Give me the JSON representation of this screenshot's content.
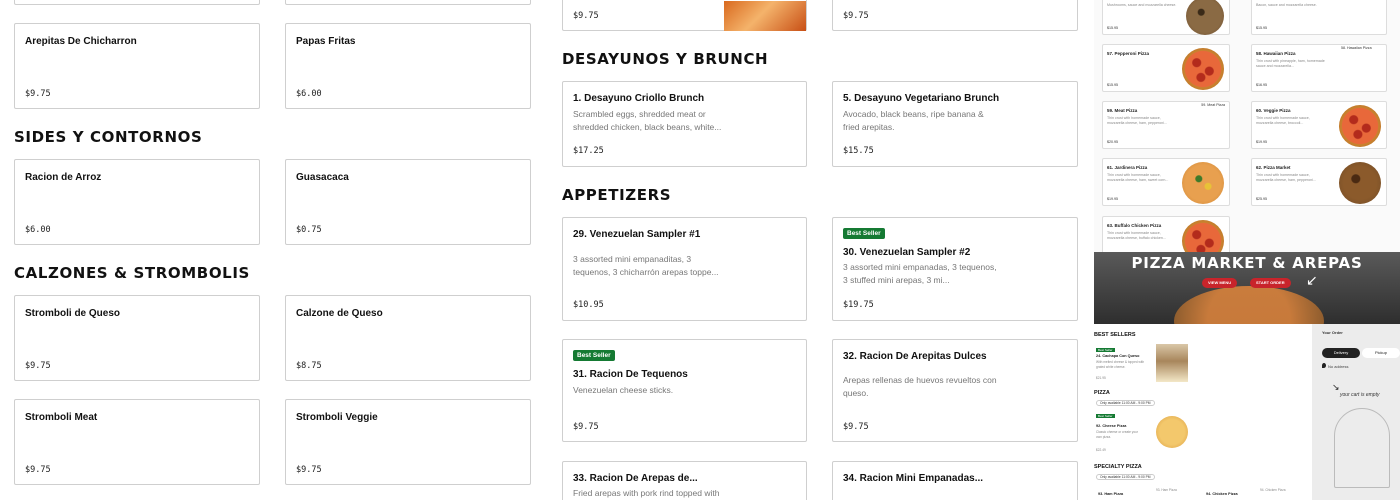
{
  "col1": {
    "top_cards": [
      {
        "name": "",
        "price": ""
      },
      {
        "name": "",
        "price": ""
      }
    ],
    "cards_a": [
      {
        "name": "Arepitas De Chicharron",
        "price": "$9.75"
      },
      {
        "name": "Papas Fritas",
        "price": "$6.00"
      }
    ],
    "sides_title": "SIDES Y CONTORNOS",
    "sides": [
      {
        "name": "Racion de Arroz",
        "price": "$6.00"
      },
      {
        "name": "Guasacaca",
        "price": "$0.75"
      }
    ],
    "calzones_title": "CALZONES & STROMBOLIS",
    "calzones": [
      {
        "name": "Stromboli de Queso",
        "price": "$9.75"
      },
      {
        "name": "Calzone de Queso",
        "price": "$8.75"
      },
      {
        "name": "Stromboli Meat",
        "price": "$9.75"
      },
      {
        "name": "Stromboli Veggie",
        "price": "$9.75"
      }
    ]
  },
  "col2": {
    "top_cards": [
      {
        "price": "$9.75"
      },
      {
        "price": "$9.75"
      }
    ],
    "desayunos_title": "DESAYUNOS Y BRUNCH",
    "desayunos": [
      {
        "name": "1. Desayuno Criollo Brunch",
        "desc": "Scrambled eggs, shredded meat or shredded chicken, black beans, white...",
        "price": "$17.25"
      },
      {
        "name": "5. Desayuno Vegetariano Brunch",
        "desc": "Avocado, black beans, ripe banana & fried arepitas.",
        "price": "$15.75"
      }
    ],
    "appetizers_title": "APPETIZERS",
    "appetizers": [
      {
        "name": "29. Venezuelan Sampler #1",
        "badge": "",
        "desc": "3 assorted mini empanaditas, 3 tequenos, 3 chicharrón arepas toppe...",
        "price": "$10.95"
      },
      {
        "name": "30. Venezuelan Sampler #2",
        "badge": "Best Seller",
        "desc": "3 assorted mini empanadas, 3 tequenos, 3 stuffed mini arepas, 3 mi...",
        "price": "$19.75"
      },
      {
        "name": "31. Racion De Tequenos",
        "badge": "Best Seller",
        "desc": "Venezuelan cheese sticks.",
        "price": "$9.75"
      },
      {
        "name": "32. Racion De Arepitas Dulces",
        "badge": "",
        "desc": "Arepas rellenas de huevos revueltos con queso.",
        "price": "$9.75"
      },
      {
        "name": "33. Racion De Arepas de...",
        "badge": "",
        "desc": "Fried arepas with pork rind topped with",
        "price": ""
      },
      {
        "name": "34. Racion Mini Empanadas...",
        "badge": "",
        "desc": "",
        "price": ""
      }
    ]
  },
  "preview": {
    "top_row": [
      {
        "desc": "Mushrooms, sauce and mozzarella cheese.",
        "price": "$15.95"
      },
      {
        "desc": "Bacon, sauce and mozzarella cheese.",
        "price": "$15.95"
      }
    ],
    "pizzas": [
      {
        "name": "57. Pepperoni Pizza",
        "desc": "",
        "price": "$15.95",
        "style": "pep"
      },
      {
        "name": "58. Hawaiian Pizza",
        "desc": "Thin crust with pineapple, ham, homemade sauce and mozzarella...",
        "price": "$16.95",
        "style": "none",
        "alt": "58. Hawaiian Pizza"
      },
      {
        "name": "59. Meat Pizza",
        "desc": "Thin crust with homemade sauce, mozzarella cheese, ham, pepperoni...",
        "price": "$20.95",
        "style": "none",
        "alt": "59. Meat Pizza"
      },
      {
        "name": "60. Veggie Pizza",
        "desc": "Thin crust with homemade sauce, mozzarella cheese, broccoli...",
        "price": "$19.95",
        "style": "pep"
      },
      {
        "name": "61. Jardinera Pizza",
        "desc": "Thin crust with homemade sauce, mozzarella cheese, ham, sweet corn...",
        "price": "$19.95",
        "style": "jard"
      },
      {
        "name": "62. Pizza Market",
        "desc": "Thin crust with homemade sauce, mozzarella cheese, ham, pepperoni...",
        "price": "$25.95",
        "style": "market"
      },
      {
        "name": "63. Buffalo Chicken Pizza",
        "desc": "Thin crust with homemade sauce, mozzarella cheese, buffalo chicken...",
        "price": "",
        "style": "pep"
      }
    ],
    "hero_title": "PIZZA MARKET & AREPAS",
    "view_menu": "VIEW MENU",
    "start_order": "START ORDER",
    "best_sellers": "BEST SELLERS",
    "bs_badge": "Best Seller",
    "bs_item": "24. Cachapa Con Queso",
    "bs_item_desc": "With melted cheese & topped with grated white cheese.",
    "bs_item_price": "$21.95",
    "pizza_label": "PIZZA",
    "availability": "Only available 11:00 AM - 9:00 PM",
    "pizza_item": "92. Cheese Pizza",
    "pizza_item_desc": "Classic cheese or create your own pizza.",
    "pizza_item_price": "$22.49",
    "specialty_label": "SPECIALTY PIZZA",
    "specialty_avail": "Only available 11:00 AM - 9:00 PM",
    "specialty_items": [
      "93. Ham Pizza",
      "93. Ham Pizza",
      "94. Chicken Pizza",
      "94. Chicken Pizza"
    ],
    "order_title": "Your Order",
    "delivery": "Delivery",
    "pickup": "Pickup",
    "no_address": "No address",
    "cart_empty": "your cart is empty"
  }
}
